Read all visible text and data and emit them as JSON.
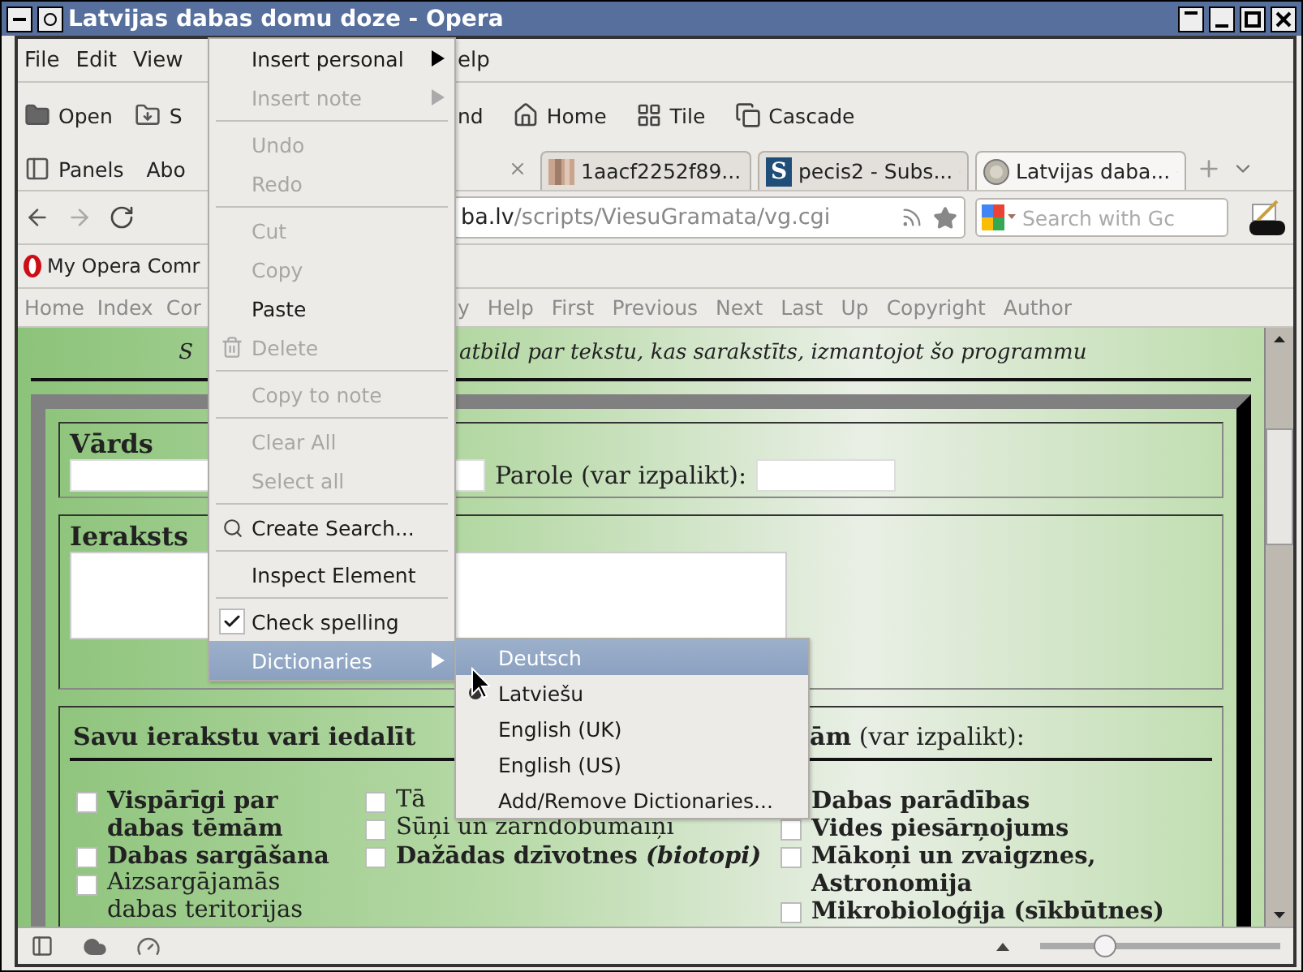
{
  "window": {
    "title": "Latvijas dabas domu doze - Opera"
  },
  "menu_bar": {
    "left": [
      "File",
      "Edit",
      "View"
    ],
    "right": [
      "elp"
    ]
  },
  "toolbar": {
    "left": [
      "Open",
      "S"
    ],
    "right": [
      "nd",
      "Home",
      "Tile",
      "Cascade"
    ]
  },
  "tab_bar": {
    "panels": "Panels",
    "fragment": "Abo",
    "tabs": [
      {
        "title": "1aacf2252f89...",
        "selected": false
      },
      {
        "title": "pecis2 - Subs...",
        "glyph": "S",
        "selected": false
      },
      {
        "title": "Latvijas daba...",
        "selected": true
      }
    ]
  },
  "address_bar": {
    "host": "ba.lv",
    "path": "/scripts/ViesuGramata/vg.cgi",
    "search_placeholder": "Search with Gc"
  },
  "bookmarks": [
    "My Opera Comr"
  ],
  "nav_links": {
    "left": [
      "Home",
      "Index",
      "Cor"
    ],
    "right": [
      "y",
      "Help",
      "First",
      "Previous",
      "Next",
      "Last",
      "Up",
      "Copyright",
      "Author"
    ]
  },
  "page": {
    "intro_left": "S",
    "intro_right": "atbild par tekstu, kas sarakstīts, izmantojot šo programmu",
    "name_label": "Vārds",
    "password_label": "Parole (var izpalikt):",
    "entry_label": "Ieraksts",
    "category_left": "Savu ierakstu vari iedalīt",
    "category_right": "**ām** (var izpalikt):",
    "columns": [
      [
        {
          "text": "Vispārīgi par dabas tēmām",
          "bold": true,
          "checked": false
        },
        {
          "text": "Dabas sargāšana",
          "bold": true,
          "checked": false
        },
        {
          "text": "Aizsargājamās dabas teritorijas",
          "bold": false,
          "checked": false
        }
      ],
      [
        {
          "text": "Tā",
          "bold": false,
          "checked": false
        },
        {
          "text": "Sūņi un zarndobumaiņi",
          "bold": false,
          "checked": false
        },
        {
          "text": "Dažādas dzīvotnes *(biotopi)*",
          "bold": true,
          "checked": false
        }
      ],
      [
        {
          "text": "Dabas parādības",
          "bold": true
        },
        {
          "text": "Vides piesārņojums",
          "bold": true,
          "checked": false
        },
        {
          "text": "Mākoņi un zvaigznes, Astronomija",
          "bold": true,
          "checked": false
        },
        {
          "text": "Mikrobioloģija (sīkbūtnes)",
          "bold": true,
          "checked": false
        }
      ]
    ]
  },
  "context_menu": {
    "items": [
      {
        "kind": "item",
        "label": "Insert personal",
        "disabled": false,
        "submenu": true,
        "selected": false
      },
      {
        "kind": "item",
        "label": "Insert note",
        "disabled": true,
        "submenu": true,
        "selected": false
      },
      {
        "kind": "separator"
      },
      {
        "kind": "item",
        "label": "Undo",
        "disabled": true,
        "selected": false
      },
      {
        "kind": "item",
        "label": "Redo",
        "disabled": true,
        "selected": false
      },
      {
        "kind": "separator"
      },
      {
        "kind": "item",
        "label": "Cut",
        "disabled": true,
        "selected": false
      },
      {
        "kind": "item",
        "label": "Copy",
        "disabled": true,
        "selected": false
      },
      {
        "kind": "item",
        "label": "Paste",
        "disabled": false,
        "selected": false
      },
      {
        "kind": "item",
        "label": "Delete",
        "disabled": true,
        "selected": false
      },
      {
        "kind": "separator"
      },
      {
        "kind": "item",
        "label": "Copy to note",
        "disabled": true,
        "selected": false
      },
      {
        "kind": "separator"
      },
      {
        "kind": "item",
        "label": "Clear All",
        "disabled": true,
        "selected": false
      },
      {
        "kind": "item",
        "label": "Select all",
        "disabled": true,
        "selected": false
      },
      {
        "kind": "separator"
      },
      {
        "kind": "item",
        "label": "Create Search...",
        "disabled": false,
        "selected": false
      },
      {
        "kind": "separator"
      },
      {
        "kind": "item",
        "label": "Inspect Element",
        "disabled": false,
        "selected": false
      },
      {
        "kind": "separator"
      },
      {
        "kind": "check",
        "label": "Check spelling",
        "checked": true,
        "disabled": false,
        "selected": false
      },
      {
        "kind": "item",
        "label": "Dictionaries",
        "disabled": false,
        "submenu": true,
        "selected": true
      }
    ]
  },
  "submenu": {
    "items": [
      {
        "kind": "radio",
        "label": "Deutsch",
        "checked": false,
        "selected": true
      },
      {
        "kind": "radio",
        "label": "Latviešu",
        "checked": true,
        "selected": false
      },
      {
        "kind": "radio",
        "label": "English (UK)",
        "checked": false,
        "selected": false
      },
      {
        "kind": "radio",
        "label": "English (US)",
        "checked": false,
        "selected": false
      },
      {
        "kind": "item",
        "label": "Add/Remove Dictionaries...",
        "selected": false
      }
    ]
  },
  "status_bar": {
    "zoom": {
      "level": 0.27
    }
  }
}
